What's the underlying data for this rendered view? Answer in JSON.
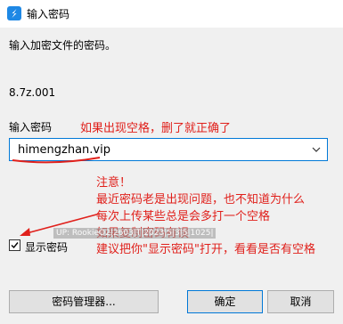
{
  "window": {
    "title": "输入密码"
  },
  "prompt": {
    "message": "输入加密文件的密码。",
    "filename": "8.7z.001"
  },
  "password": {
    "label": "输入密码",
    "value": "himengzhan.vip",
    "hint": "如果出现空格，删了就正确了"
  },
  "note": {
    "lines": [
      "注意！",
      "最近密码老是出现问题，也不知道为什么",
      "每次上传某些总是会多打一个空格",
      "如果复制密码有误",
      "建议把你\"显示密码\"打开，看看是否有空格"
    ]
  },
  "watermark": "UP: RookieO2|2603|T|2023|5|3|5|1025|",
  "show_password": {
    "label": "显示密码",
    "checked": true
  },
  "buttons": {
    "manager": "密码管理器...",
    "ok": "确定",
    "cancel": "取消"
  },
  "colors": {
    "accent": "#0078d7",
    "annotation": "#e0201b"
  }
}
